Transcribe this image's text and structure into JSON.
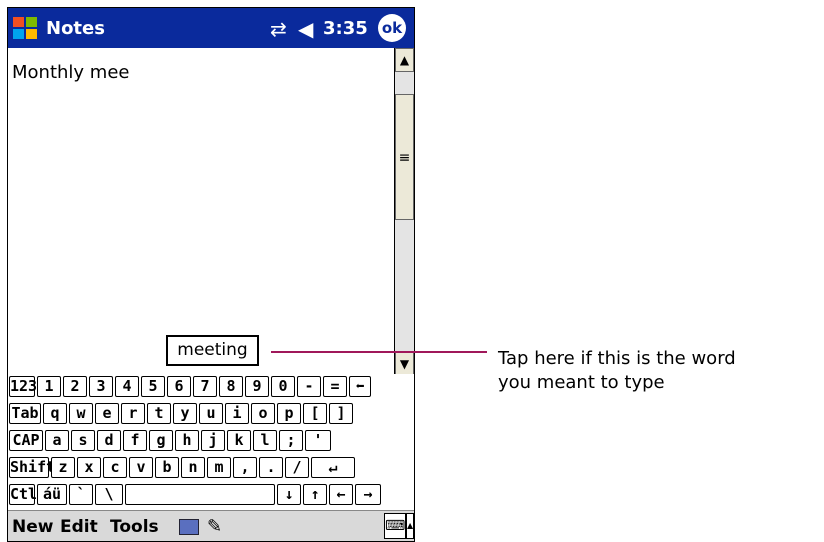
{
  "titlebar": {
    "app_title": "Notes",
    "clock": "3:35",
    "ok_label": "ok",
    "connectivity_icon": "connectivity-icon",
    "volume_icon": "volume-icon"
  },
  "note": {
    "text": "Monthly mee"
  },
  "suggestion": {
    "word": "meeting"
  },
  "keyboard": {
    "rows": [
      [
        "123",
        "1",
        "2",
        "3",
        "4",
        "5",
        "6",
        "7",
        "8",
        "9",
        "0",
        "-",
        "=",
        "⬅"
      ],
      [
        "Tab",
        "q",
        "w",
        "e",
        "r",
        "t",
        "y",
        "u",
        "i",
        "o",
        "p",
        "[",
        "]"
      ],
      [
        "CAP",
        "a",
        "s",
        "d",
        "f",
        "g",
        "h",
        "j",
        "k",
        "l",
        ";",
        "'"
      ],
      [
        "Shift",
        "z",
        "x",
        "c",
        "v",
        "b",
        "n",
        "m",
        ",",
        ".",
        "/",
        "↵"
      ],
      [
        "Ctl",
        "áü",
        "`",
        "\\",
        "",
        "↓",
        "↑",
        "←",
        "→"
      ]
    ]
  },
  "menubar": {
    "new_label": "New",
    "edit_label": "Edit",
    "tools_label": "Tools"
  },
  "callout": {
    "line1": "Tap here if this is the word",
    "line2": "you meant to type"
  },
  "colors": {
    "titlebar": "#0a2a9c",
    "callout_line": "#a0185a"
  }
}
